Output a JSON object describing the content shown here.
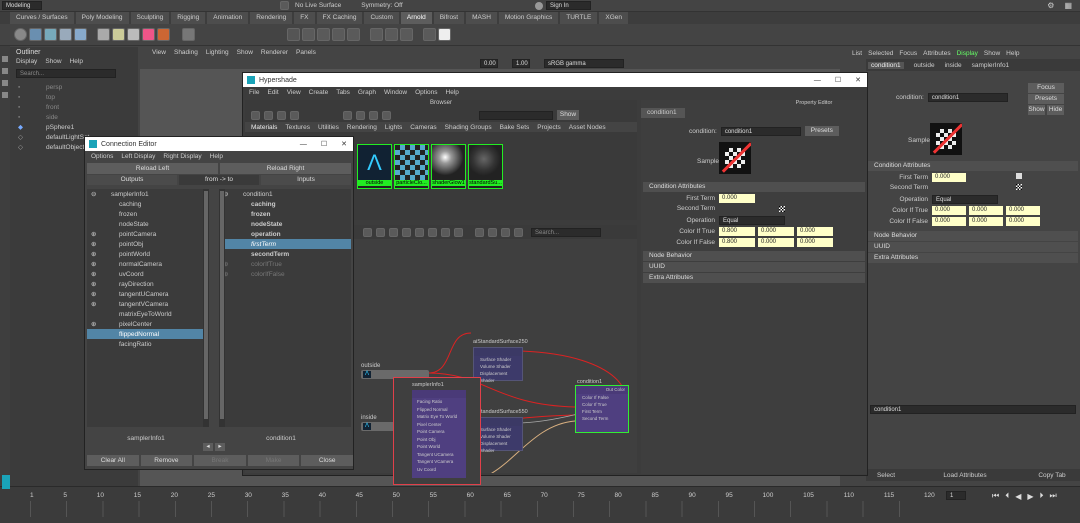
{
  "top": {
    "menu_left": "Modeling",
    "live_surface": "No Live Surface",
    "symmetry": "Symmetry: Off",
    "sign_in": "Sign In",
    "shelf_tabs": [
      "Curves / Surfaces",
      "Poly Modeling",
      "Sculpting",
      "Rigging",
      "Animation",
      "Rendering",
      "FX",
      "FX Caching",
      "Custom",
      "Arnold",
      "Bifrost",
      "MASH",
      "Motion Graphics",
      "TURTLE",
      "XGen"
    ],
    "active_shelf": "Arnold"
  },
  "viewport_menu": [
    "View",
    "Shading",
    "Lighting",
    "Show",
    "Renderer",
    "Panels"
  ],
  "viewport_fields": {
    "v1": "0.00",
    "v2": "1.00",
    "colorspace": "sRGB gamma"
  },
  "outliner": {
    "title": "Outliner",
    "menu": [
      "Display",
      "Show",
      "Help"
    ],
    "search": "Search...",
    "items": [
      "persp",
      "top",
      "front",
      "side",
      "pSphere1",
      "defaultLightSet",
      "defaultObjectSet"
    ]
  },
  "right_panel": {
    "menu": [
      "List",
      "Selected",
      "Focus",
      "Attributes",
      "Display",
      "Show",
      "Help"
    ],
    "tabs": [
      "condition1",
      "outside",
      "inside",
      "samplerInfo1"
    ],
    "node_label": "condition:",
    "node_value": "condition1",
    "focus_btn": "Focus",
    "presets_btn": "Presets",
    "show_btn": "Show",
    "hide_btn": "Hide",
    "sample_label": "Sample",
    "sections": [
      "Condition Attributes",
      "Node Behavior",
      "UUID",
      "Extra Attributes"
    ],
    "first_term_label": "First Term",
    "first_term_value": "0.000",
    "second_term_label": "Second Term",
    "operation_label": "Operation",
    "operation_value": "Equal",
    "color_true_label": "Color If True",
    "color_true": [
      "0.000",
      "0.000",
      "0.000"
    ],
    "color_false_label": "Color If False",
    "color_false": [
      "0.000",
      "0.000",
      "0.000"
    ],
    "bottom_field": "condition1",
    "bottom_buttons": [
      "Select",
      "Load Attributes",
      "Copy Tab"
    ]
  },
  "hypershade": {
    "title": "Hypershade",
    "menu": [
      "File",
      "Edit",
      "View",
      "Create",
      "Tabs",
      "Graph",
      "Window",
      "Options",
      "Help"
    ],
    "browser_title": "Browser",
    "show_btn": "Show",
    "browser_tabs": [
      "Materials",
      "Textures",
      "Utilities",
      "Rendering",
      "Lights",
      "Cameras",
      "Shading Groups",
      "Bake Sets",
      "Projects",
      "Asset Nodes"
    ],
    "swatches": [
      "outside",
      "particleClo...",
      "shaderGlow1",
      "standardSu..."
    ],
    "graph_search": "Search...",
    "nodes": {
      "outside": "outside",
      "inside": "inside",
      "std1_title": "aiStandardSurface250",
      "std1_ports": [
        "Surface Shader",
        "Volume Shader",
        "Displacement Shader"
      ],
      "std2_title": "aiStandardSurface550",
      "std2_ports": [
        "Surface Shader",
        "Volume Shader",
        "Displacement Shader"
      ],
      "cond_title": "condition1",
      "cond_ports": [
        "Out Color",
        "Color If False",
        "Color If True",
        "First Term",
        "Second Term"
      ],
      "sampler_title": "samplerInfo1",
      "sampler_ports": [
        "Facing Ratio",
        "Flipped Normal",
        "Matrix Eye To World",
        "Pixel Center",
        "Point Camera",
        "Point Obj",
        "Point World",
        "Tangent UCamera",
        "Tangent VCamera",
        "Uv Coord"
      ]
    },
    "pe_title": "Property Editor",
    "pe_tab": "condition1",
    "pe_node_label": "condition:",
    "pe_node_value": "condition1",
    "pe_presets": "Presets",
    "pe_sample": "Sample",
    "pe_sections": [
      "Condition Attributes",
      "Node Behavior",
      "UUID",
      "Extra Attributes"
    ],
    "pe_first_label": "First Term",
    "pe_first_value": "0.000",
    "pe_second_label": "Second Term",
    "pe_operation_label": "Operation",
    "pe_operation_value": "Equal",
    "pe_true_label": "Color If True",
    "pe_true": [
      "0.800",
      "0.000",
      "0.000"
    ],
    "pe_false_label": "Color If False",
    "pe_false": [
      "0.800",
      "0.000",
      "0.000"
    ]
  },
  "connection_editor": {
    "title": "Connection Editor",
    "menu": [
      "Options",
      "Left Display",
      "Right Display",
      "Help"
    ],
    "reload_left": "Reload Left",
    "reload_right": "Reload Right",
    "outputs": "Outputs",
    "direction": "from -> to",
    "inputs": "Inputs",
    "left_items": [
      "samplerInfo1",
      "caching",
      "frozen",
      "nodeState",
      "pointCamera",
      "pointObj",
      "pointWorld",
      "normalCamera",
      "uvCoord",
      "rayDirection",
      "tangentUCamera",
      "tangentVCamera",
      "matrixEyeToWorld",
      "pixelCenter",
      "flippedNormal",
      "facingRatio"
    ],
    "left_selected": "flippedNormal",
    "right_items": [
      "condition1",
      "caching",
      "frozen",
      "nodeState",
      "operation",
      "firstTerm",
      "secondTerm",
      "colorIfTrue",
      "colorIfFalse"
    ],
    "right_selected": "firstTerm",
    "left_node": "samplerInfo1",
    "right_node": "condition1",
    "buttons": [
      "Clear All",
      "Remove",
      "Break",
      "Make",
      "Close"
    ]
  },
  "timeline": {
    "ticks": [
      "1",
      "5",
      "10",
      "15",
      "20",
      "25",
      "30",
      "35",
      "40",
      "45",
      "50",
      "55",
      "60",
      "65",
      "70",
      "75",
      "80",
      "85",
      "90",
      "95",
      "100",
      "105",
      "110",
      "115",
      "120"
    ],
    "current": "1"
  }
}
